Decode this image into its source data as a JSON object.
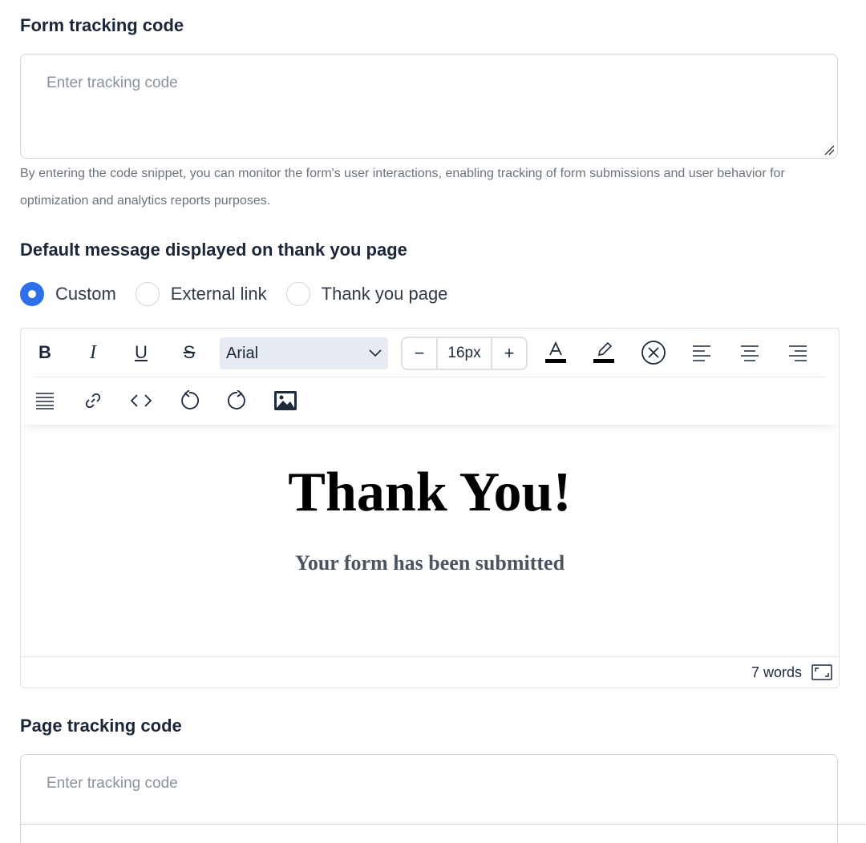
{
  "form_tracking": {
    "title": "Form tracking code",
    "placeholder": "Enter tracking code",
    "help_text": "By entering the code snippet, you can monitor the form's user interactions, enabling tracking of form submissions and user behavior for optimization and analytics reports purposes."
  },
  "thank_you": {
    "title": "Default message displayed on thank you page",
    "options": [
      {
        "label": "Custom",
        "checked": true
      },
      {
        "label": "External link",
        "checked": false
      },
      {
        "label": "Thank you page",
        "checked": false
      }
    ]
  },
  "editor": {
    "toolbar": {
      "bold_icon": "bold-icon",
      "italic_icon": "italic-icon",
      "underline_icon": "underline-icon",
      "strikethrough_icon": "strikethrough-icon",
      "font_family": "Arial",
      "font_size": "16px",
      "decrease_label": "−",
      "increase_label": "+",
      "text_color": "#000000",
      "highlight_color": "#000000"
    },
    "content": {
      "heading": "Thank You!",
      "subheading": "Your form has been submitted"
    },
    "status": {
      "word_count": "7 words"
    }
  },
  "page_tracking": {
    "title": "Page tracking code",
    "placeholder": "Enter tracking code"
  },
  "colors": {
    "accent": "#2f6fec",
    "heading_text": "#1b2738",
    "muted_text": "#6b737d"
  }
}
